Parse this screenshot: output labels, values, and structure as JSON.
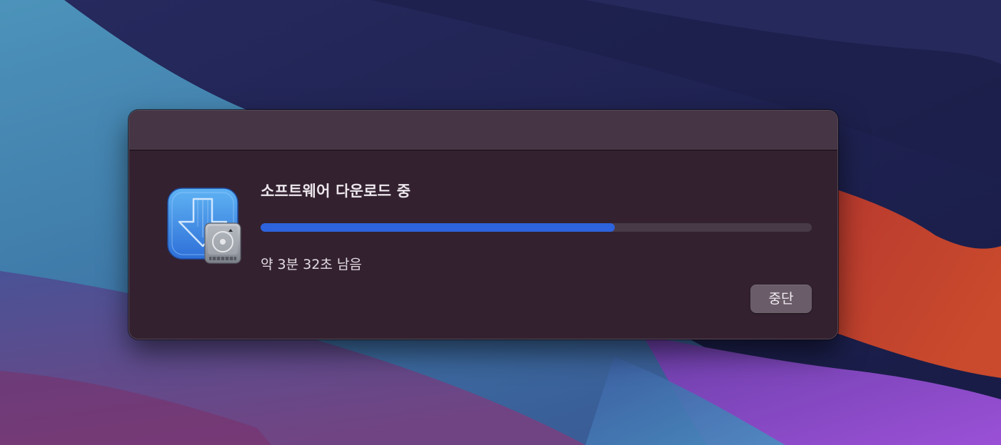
{
  "dialog": {
    "title": "소프트웨어 다운로드 중",
    "progress_fraction": 0.643,
    "status": "약 3분 32초 남음",
    "stop_label": "중단",
    "app_icon": "software-download-drive-icon"
  },
  "colors": {
    "dialog_background": "#332130",
    "titlebar_background": "#463645",
    "progress_fill": "#2d63dc",
    "progress_track": "#493a48",
    "button_background": "#6a5d69"
  }
}
